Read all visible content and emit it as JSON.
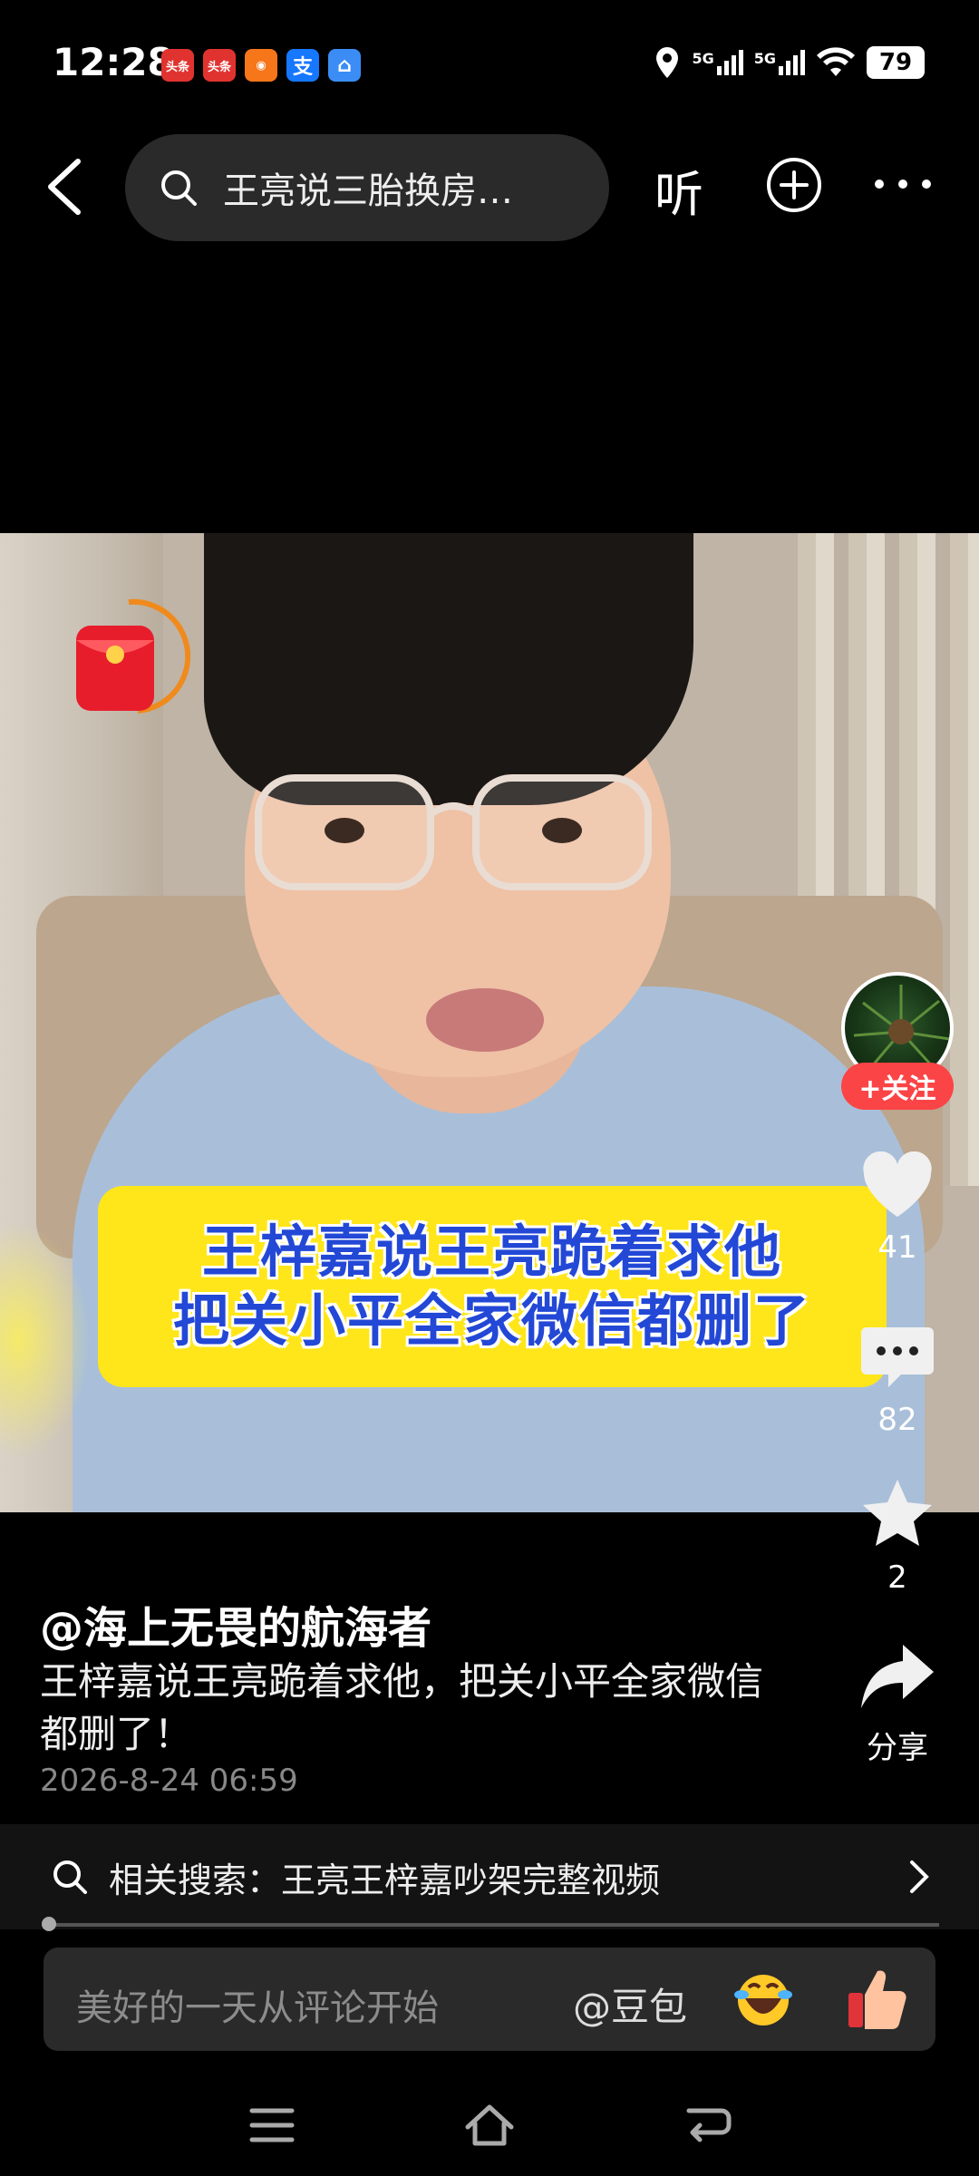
{
  "status_bar": {
    "time": "12:28",
    "notifications": [
      "头条",
      "头条",
      "",
      "支",
      "",
      ""
    ],
    "signal": "5G",
    "battery": "79"
  },
  "top_bar": {
    "search_text": "王亮说三胎换房…",
    "listen_label": "听"
  },
  "video": {
    "caption_line1": "王梓嘉说王亮跪着求他",
    "caption_line2": "把关小平全家微信都删了"
  },
  "sidebar": {
    "follow_label": "+关注",
    "likes": "41",
    "comments": "82",
    "favorites": "2",
    "share_label": "分享"
  },
  "info": {
    "author": "@海上无畏的航海者",
    "description": "王梓嘉说王亮跪着求他，把关小平全家微信都删了！",
    "date": "2026-8-24 06:59"
  },
  "related_search": {
    "text": "相关搜索：王亮王梓嘉吵架完整视频"
  },
  "comment_bar": {
    "placeholder": "美好的一天从评论开始",
    "mention": "@豆包"
  },
  "colors": {
    "accent_red": "#fb4446",
    "caption_yellow": "#ffe61a",
    "caption_blue": "#2348d6"
  },
  "icons": [
    "back-icon",
    "search-icon",
    "add-circle-icon",
    "more-icon",
    "heart-icon",
    "comment-icon",
    "star-icon",
    "share-icon",
    "chevron-right-icon",
    "menu-icon",
    "home-icon",
    "back-nav-icon"
  ]
}
